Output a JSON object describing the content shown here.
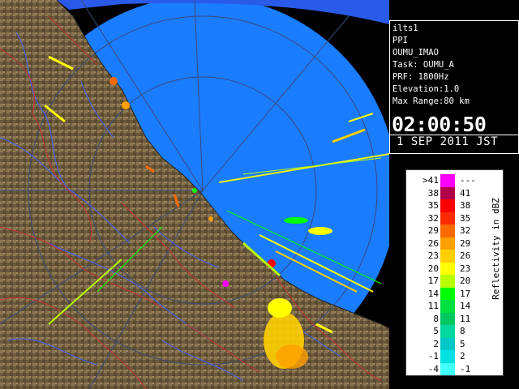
{
  "info": {
    "lines": [
      "ilts1",
      "PPI",
      "OUMU_IMAO",
      "Task: OUMU_A",
      "PRF: 1800Hz",
      "Elevation:1.0",
      "Max Range:80 km"
    ],
    "time": "02:00:50",
    "date": "1 SEP 2011 JST"
  },
  "legend": {
    "title": "Reflectivity in dBZ",
    "rows": [
      {
        "lower": ">41",
        "upper": "---",
        "color": "#ff00ff"
      },
      {
        "lower": "38",
        "upper": "41",
        "color": "#b0004a"
      },
      {
        "lower": "35",
        "upper": "38",
        "color": "#ff0000"
      },
      {
        "lower": "32",
        "upper": "35",
        "color": "#ff2a00"
      },
      {
        "lower": "29",
        "upper": "32",
        "color": "#ff6a00"
      },
      {
        "lower": "26",
        "upper": "29",
        "color": "#ff9f00"
      },
      {
        "lower": "23",
        "upper": "26",
        "color": "#ffd000"
      },
      {
        "lower": "20",
        "upper": "23",
        "color": "#ffff00"
      },
      {
        "lower": "17",
        "upper": "20",
        "color": "#b8ff00"
      },
      {
        "lower": "14",
        "upper": "17",
        "color": "#00ff00"
      },
      {
        "lower": "11",
        "upper": "14",
        "color": "#00e040"
      },
      {
        "lower": "8",
        "upper": "11",
        "color": "#00c860"
      },
      {
        "lower": "5",
        "upper": "8",
        "color": "#00d8a0"
      },
      {
        "lower": "2",
        "upper": "5",
        "color": "#00c8c8"
      },
      {
        "lower": "-1",
        "upper": "2",
        "color": "#00e0e0"
      },
      {
        "lower": "-4",
        "upper": "-1",
        "color": "#40ffff"
      }
    ]
  },
  "colors": {
    "sea_outer": "#2050e0",
    "sea_inner": "#1a7cff",
    "land": "#6b5a3c",
    "land_light": "#9a8458",
    "river": "#3a5cff",
    "boundary": "#c02a2a",
    "range_ring": "#555555"
  }
}
